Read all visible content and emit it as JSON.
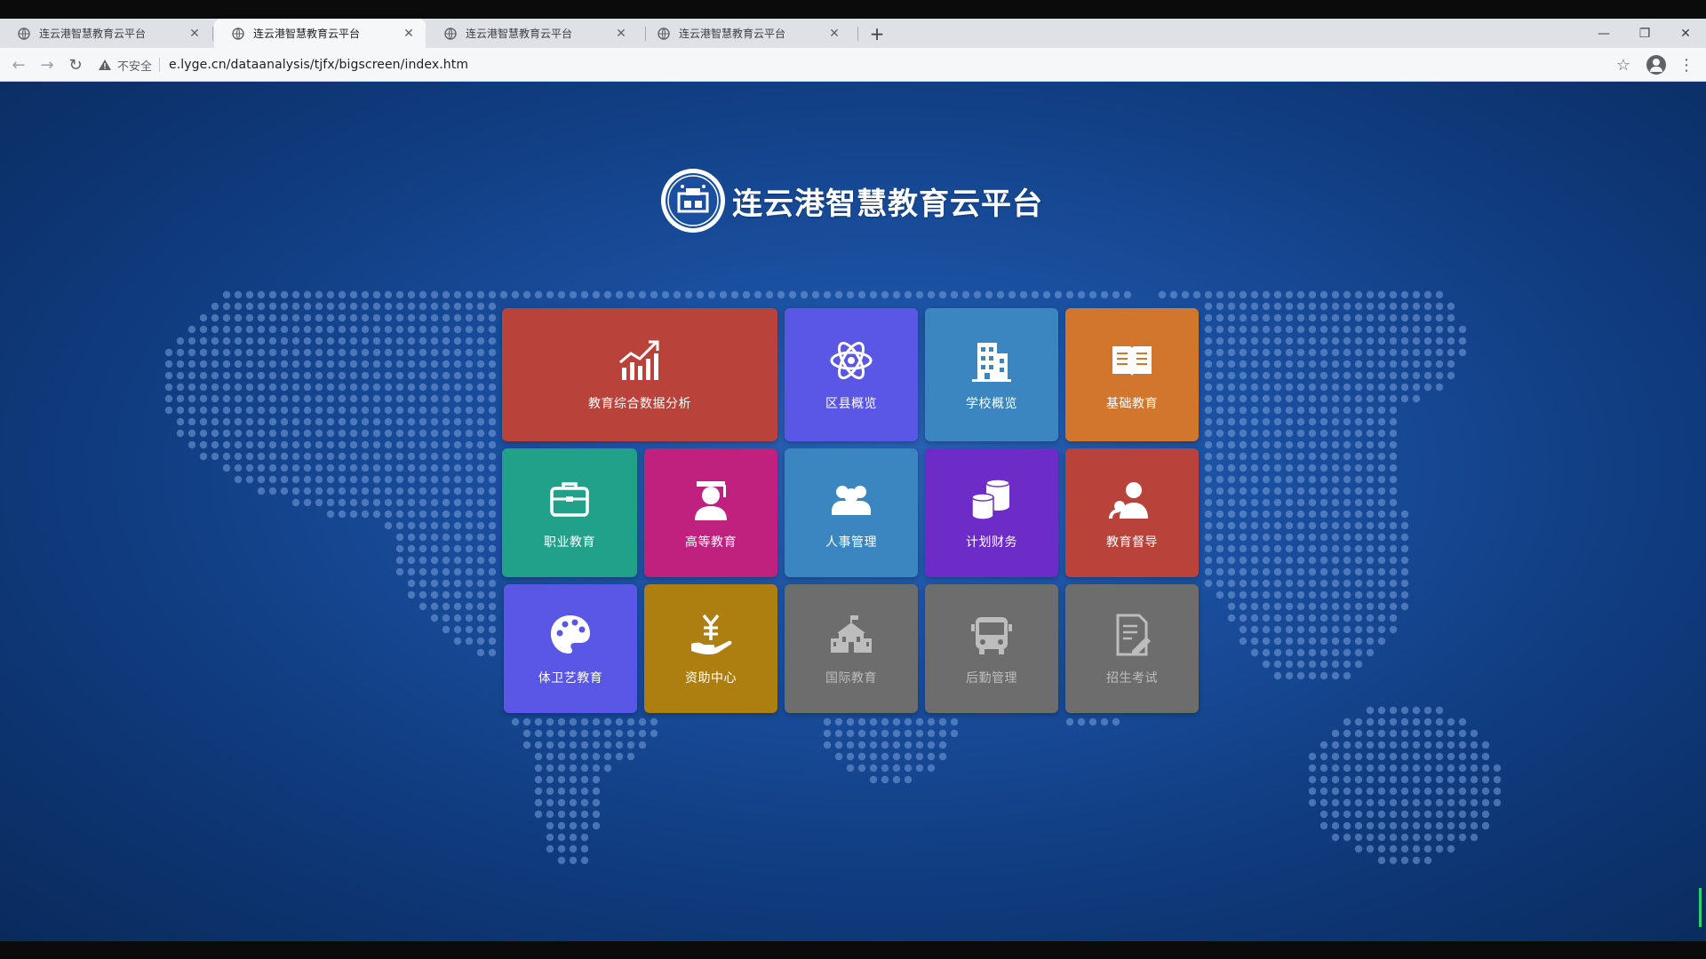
{
  "browser": {
    "tabs": [
      {
        "title": "连云港智慧教育云平台",
        "active": false
      },
      {
        "title": "连云港智慧教育云平台",
        "active": true
      },
      {
        "title": "连云港智慧教育云平台",
        "active": false
      },
      {
        "title": "连云港智慧教育云平台",
        "active": false
      }
    ],
    "security_label": "不安全",
    "url": "e.lyge.cn/dataanalysis/tjfx/bigscreen/index.htm"
  },
  "page": {
    "title": "连云港智慧教育云平台"
  },
  "tiles": [
    {
      "label": "教育综合数据分析",
      "icon": "chart-trend-icon",
      "color": "#b9433a"
    },
    {
      "label": "区县概览",
      "icon": "atom-icon",
      "color": "#5b57e6"
    },
    {
      "label": "学校概览",
      "icon": "building-icon",
      "color": "#3b86c1"
    },
    {
      "label": "基础教育",
      "icon": "open-book-icon",
      "color": "#d2762e"
    },
    {
      "label": "职业教育",
      "icon": "briefcase-icon",
      "color": "#21a08a"
    },
    {
      "label": "高等教育",
      "icon": "graduate-icon",
      "color": "#c0207e"
    },
    {
      "label": "人事管理",
      "icon": "people-icon",
      "color": "#3b86c1"
    },
    {
      "label": "计划财务",
      "icon": "coins-icon",
      "color": "#6d2cc7"
    },
    {
      "label": "教育督导",
      "icon": "supervisor-icon",
      "color": "#b9433a"
    },
    {
      "label": "体卫艺教育",
      "icon": "palette-icon",
      "color": "#5b57e6"
    },
    {
      "label": "资助中心",
      "icon": "yuan-hand-icon",
      "color": "#ad7e10"
    },
    {
      "label": "国际教育",
      "icon": "school-building-icon",
      "color": "#6d6d6d"
    },
    {
      "label": "后勤管理",
      "icon": "bus-icon",
      "color": "#6d6d6d"
    },
    {
      "label": "招生考试",
      "icon": "exam-paper-icon",
      "color": "#6d6d6d"
    }
  ]
}
